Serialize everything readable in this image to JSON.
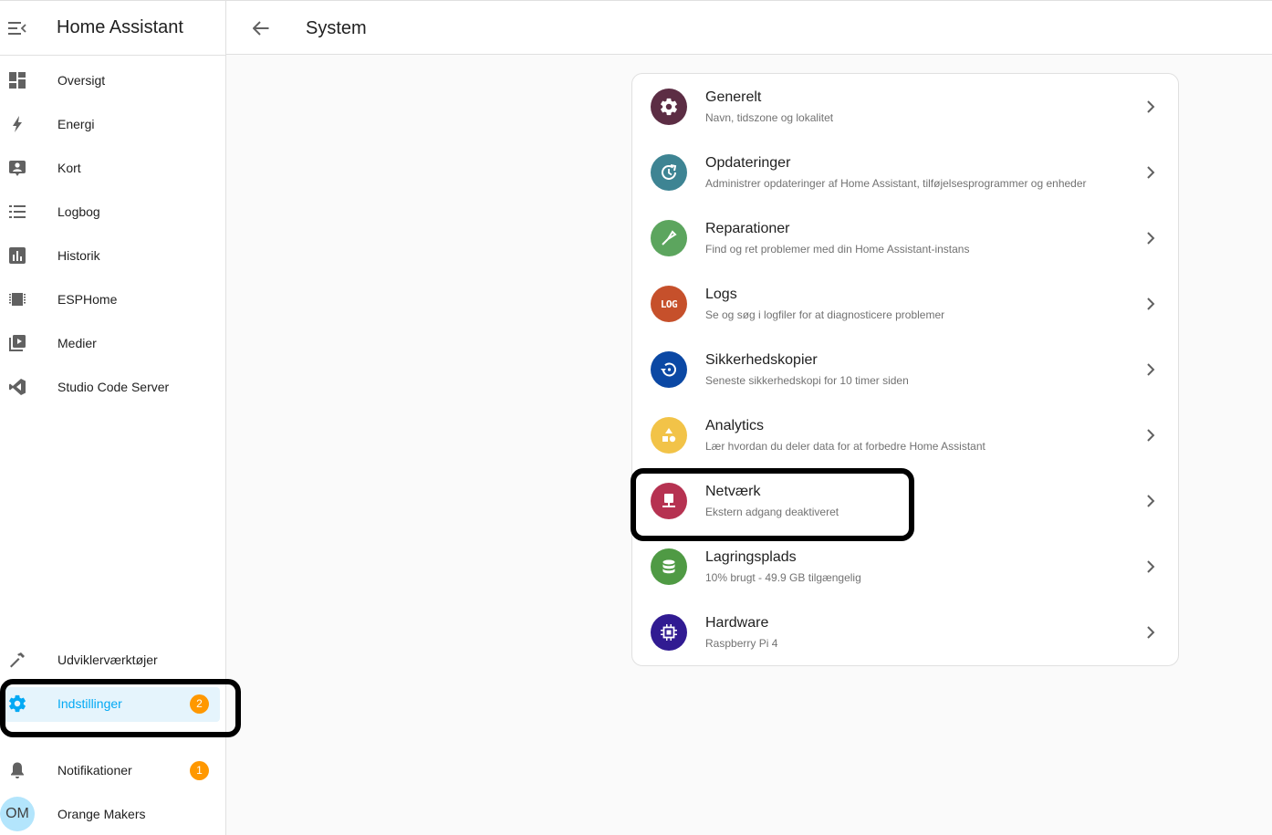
{
  "app": {
    "title": "Home Assistant"
  },
  "sidebar": {
    "items": [
      {
        "label": "Oversigt",
        "icon": "dashboard-icon"
      },
      {
        "label": "Energi",
        "icon": "lightning-icon"
      },
      {
        "label": "Kort",
        "icon": "map-account-icon"
      },
      {
        "label": "Logbog",
        "icon": "list-icon"
      },
      {
        "label": "Historik",
        "icon": "chart-box-icon"
      },
      {
        "label": "ESPHome",
        "icon": "chip-icon"
      },
      {
        "label": "Medier",
        "icon": "play-box-icon"
      },
      {
        "label": "Studio Code Server",
        "icon": "vscode-icon"
      }
    ],
    "bottom": {
      "dev_tools": "Udviklerværktøjer",
      "settings": "Indstillinger",
      "settings_badge": "2",
      "notifications": "Notifikationer",
      "notifications_badge": "1",
      "user_initials": "OM",
      "user_name": "Orange Makers"
    }
  },
  "header": {
    "title": "System"
  },
  "rows": [
    {
      "title": "Generelt",
      "subtitle": "Navn, tidszone og lokalitet",
      "color": "#5c2d44",
      "icon": "gear-icon"
    },
    {
      "title": "Opdateringer",
      "subtitle": "Administrer opdateringer af Home Assistant, tilføjelsesprogrammer og enheder",
      "color": "#3e8493",
      "icon": "update-icon"
    },
    {
      "title": "Reparationer",
      "subtitle": "Find og ret problemer med din Home Assistant-instans",
      "color": "#5ca55e",
      "icon": "screwdriver-icon"
    },
    {
      "title": "Logs",
      "subtitle": "Se og søg i logfiler for at diagnosticere problemer",
      "color": "#c6502b",
      "icon": "log-icon",
      "icon_text": "LOG"
    },
    {
      "title": "Sikkerhedskopier",
      "subtitle": "Seneste sikkerhedskopi for 10 timer siden",
      "color": "#0b48a4",
      "icon": "backup-restore-icon"
    },
    {
      "title": "Analytics",
      "subtitle": "Lær hvordan du deler data for at forbedre Home Assistant",
      "color": "#f2c348",
      "icon": "shapes-icon"
    },
    {
      "title": "Netværk",
      "subtitle": "Ekstern adgang deaktiveret",
      "color": "#b63251",
      "icon": "network-icon"
    },
    {
      "title": "Lagringsplads",
      "subtitle": "10% brugt - 49.9 GB tilgængelig",
      "color": "#4f9a44",
      "icon": "database-icon"
    },
    {
      "title": "Hardware",
      "subtitle": "Raspberry Pi 4",
      "color": "#311b92",
      "icon": "cpu-icon"
    }
  ],
  "colors": {
    "accent": "#03a9f4",
    "badge": "#ff9800",
    "highlight": "#000000"
  }
}
